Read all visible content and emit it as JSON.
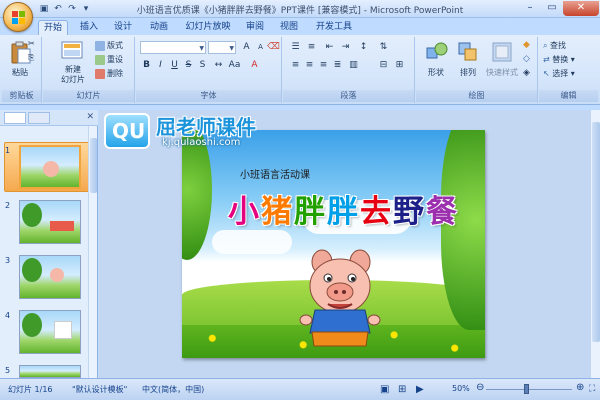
{
  "window": {
    "title": "小班语言优质课《小猪胖胖去野餐》PPT课件 [兼容模式] - Microsoft PowerPoint"
  },
  "ribbon": {
    "tabs": [
      {
        "label": "开始",
        "active": true
      },
      {
        "label": "插入"
      },
      {
        "label": "设计"
      },
      {
        "label": "动画"
      },
      {
        "label": "幻灯片放映"
      },
      {
        "label": "审阅"
      },
      {
        "label": "视图"
      },
      {
        "label": "开发工具"
      }
    ],
    "clipboard": {
      "paste": "粘贴",
      "group": "剪贴板"
    },
    "slides": {
      "new_slide_line1": "新建",
      "new_slide_line2": "幻灯片",
      "layout": "版式",
      "reset": "重设",
      "delete": "删除",
      "group": "幻灯片"
    },
    "font": {
      "group": "字体"
    },
    "paragraph": {
      "group": "段落"
    },
    "drawing": {
      "shape": "形状",
      "arrange": "排列",
      "quick_styles": "快速样式",
      "group": "绘图"
    },
    "editing": {
      "find": "查找",
      "replace": "替换",
      "select": "选择",
      "group": "编辑"
    }
  },
  "watermark": {
    "logo": "QU",
    "title": "屈老师课件",
    "url": "kj.qulaoshi.com"
  },
  "slide": {
    "subtitle": "小班语言活动课",
    "title_chars": [
      {
        "ch": "小",
        "color": "#e4007f"
      },
      {
        "ch": "猪",
        "color": "#ff7a00"
      },
      {
        "ch": "胖",
        "color": "#22a000"
      },
      {
        "ch": "胖",
        "color": "#00a0e9"
      },
      {
        "ch": "去",
        "color": "#e60012"
      },
      {
        "ch": "野",
        "color": "#1d2088"
      },
      {
        "ch": "餐",
        "color": "#9b2fae"
      }
    ]
  },
  "thumbnails": [
    {
      "num": "1",
      "active": true
    },
    {
      "num": "2"
    },
    {
      "num": "3"
    },
    {
      "num": "4"
    },
    {
      "num": "5"
    }
  ],
  "status": {
    "slide_info": "幻灯片 1/16",
    "theme": "\"默认设计模板\"",
    "language": "中文(简体，中国)",
    "zoom": "50%"
  },
  "colors": {
    "ribbon_bg": "#dbe8fa",
    "accent": "#f2a53d"
  }
}
